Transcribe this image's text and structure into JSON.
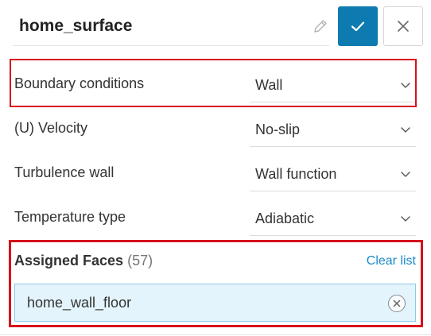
{
  "header": {
    "name_value": "home_surface",
    "edit_icon": "pencil-icon",
    "confirm_icon": "check-icon",
    "close_icon": "close-icon"
  },
  "rows": [
    {
      "label": "Boundary conditions",
      "value": "Wall"
    },
    {
      "label": "(U) Velocity",
      "value": "No-slip"
    },
    {
      "label": "Turbulence wall",
      "value": "Wall function"
    },
    {
      "label": "Temperature type",
      "value": "Adiabatic"
    }
  ],
  "assigned_faces": {
    "title": "Assigned Faces",
    "count": "(57)",
    "clear_label": "Clear list",
    "items": [
      {
        "label": "home_wall_floor"
      }
    ]
  },
  "colors": {
    "accent": "#0d7ab0",
    "link": "#1a8ac9",
    "highlight": "#d7101b",
    "chip_bg": "#e3f4fc"
  }
}
